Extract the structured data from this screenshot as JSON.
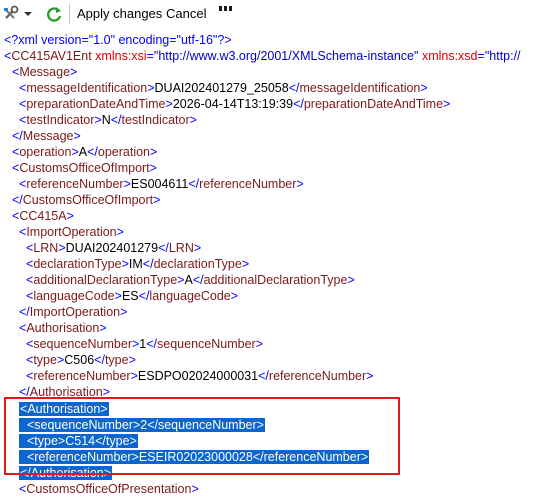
{
  "toolbar": {
    "tools_icon": "tools-icon",
    "refresh_icon": "refresh-icon",
    "apply_label": "Apply changes",
    "cancel_label": "Cancel"
  },
  "xml": {
    "decl": "<?xml version=\"1.0\" encoding=\"utf-16\"?>",
    "root_tag": "CC415AV1Ent",
    "root_attr1_name": "xmlns:xsi",
    "root_attr1_value": "\"http://www.w3.org/2001/XMLSchema-instance\"",
    "root_attr2_name": "xmlns:xsd",
    "root_attr2_value": "\"http://",
    "message": {
      "messageIdentification": "DUAI202401279_25058",
      "preparationDateAndTime": "2026-04-14T13:19:39",
      "testIndicator": "N"
    },
    "operation": "A",
    "customs_office_of_import": {
      "referenceNumber": "ES004611"
    },
    "import_operation": {
      "LRN": "DUAI202401279",
      "declarationType": "IM",
      "additionalDeclarationType": "A",
      "languageCode": "ES"
    },
    "authorisation1": {
      "sequenceNumber": "1",
      "type": "C506",
      "referenceNumber": "ESDPO02024000031"
    },
    "authorisation2": {
      "sequenceNumber": "2",
      "type": "C514",
      "referenceNumber": "ESEIR02023000028"
    },
    "last_tag": "CustomsOfficeOfPresentation"
  },
  "colors": {
    "tag": "#7a1a1a",
    "attr_name": "#e00000",
    "attr_value": "#0000cc",
    "selection": "#0b66d1",
    "highlight_box": "#e01b1b"
  }
}
